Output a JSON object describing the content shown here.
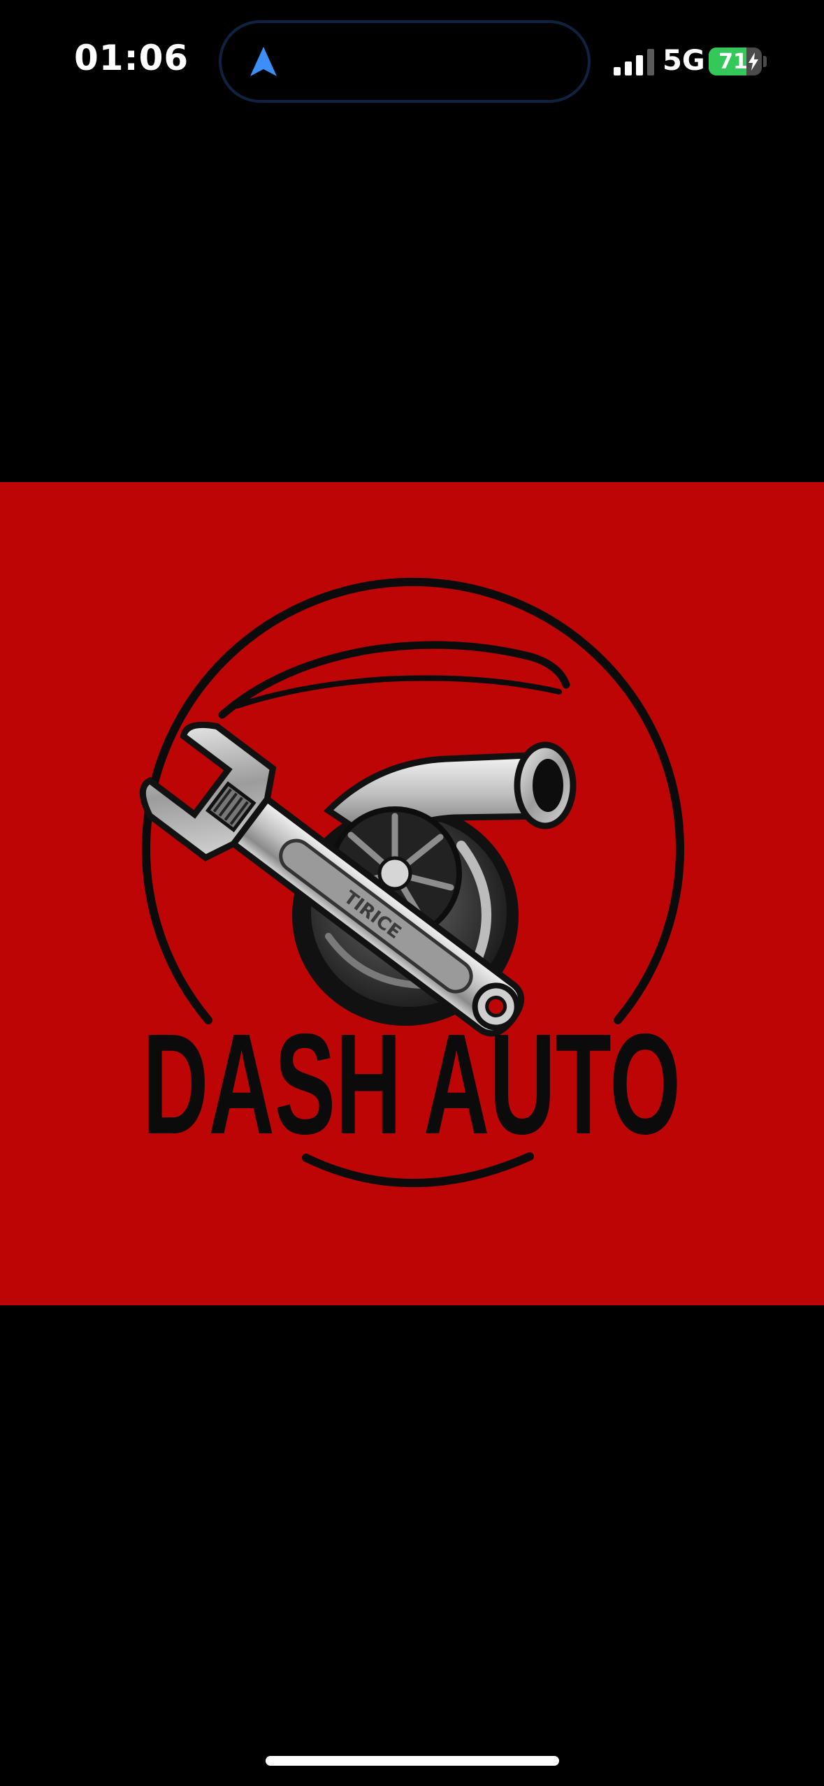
{
  "status_bar": {
    "time": "01:06",
    "network": "5G",
    "battery_level": "71",
    "battery_charging": true,
    "battery_fraction": 0.71,
    "signal_bars": 3
  },
  "image": {
    "logo_text": "DASH AUTO",
    "wrench_engraving": "TIRICE",
    "background_color": "#bd0505"
  },
  "colors": {
    "accent_location": "#3d8ef7",
    "battery_green": "#34c759"
  }
}
